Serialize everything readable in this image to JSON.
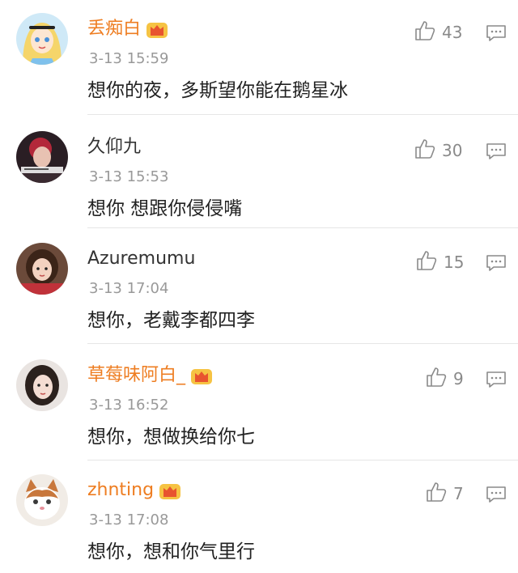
{
  "comments": [
    {
      "name": "丢痴白",
      "vip": true,
      "time": "3-13 15:59",
      "text": "想你的夜，多斯望你能在鹅星冰",
      "likes": "43"
    },
    {
      "name": "久仰九",
      "vip": false,
      "time": "3-13 15:53",
      "text": "想你 想跟你侵侵嘴",
      "likes": "30"
    },
    {
      "name": "Azuremumu",
      "vip": false,
      "time": "3-13 17:04",
      "text": "想你，老戴李都四李",
      "likes": "15"
    },
    {
      "name": "草莓味阿白_",
      "vip": true,
      "time": "3-13 16:52",
      "text": "想你，想做换给你七",
      "likes": "9"
    },
    {
      "name": "zhnting",
      "vip": true,
      "time": "3-13 17:08",
      "text": "想你，想和你气里行",
      "likes": "7"
    }
  ],
  "icons": {
    "like": "thumbs-up-icon",
    "reply": "reply-comment-icon",
    "vip": "crown-badge-icon"
  },
  "colors": {
    "vip_name": "#ee7d21",
    "normal_name": "#333333",
    "timestamp": "#999999",
    "text": "#222222"
  }
}
